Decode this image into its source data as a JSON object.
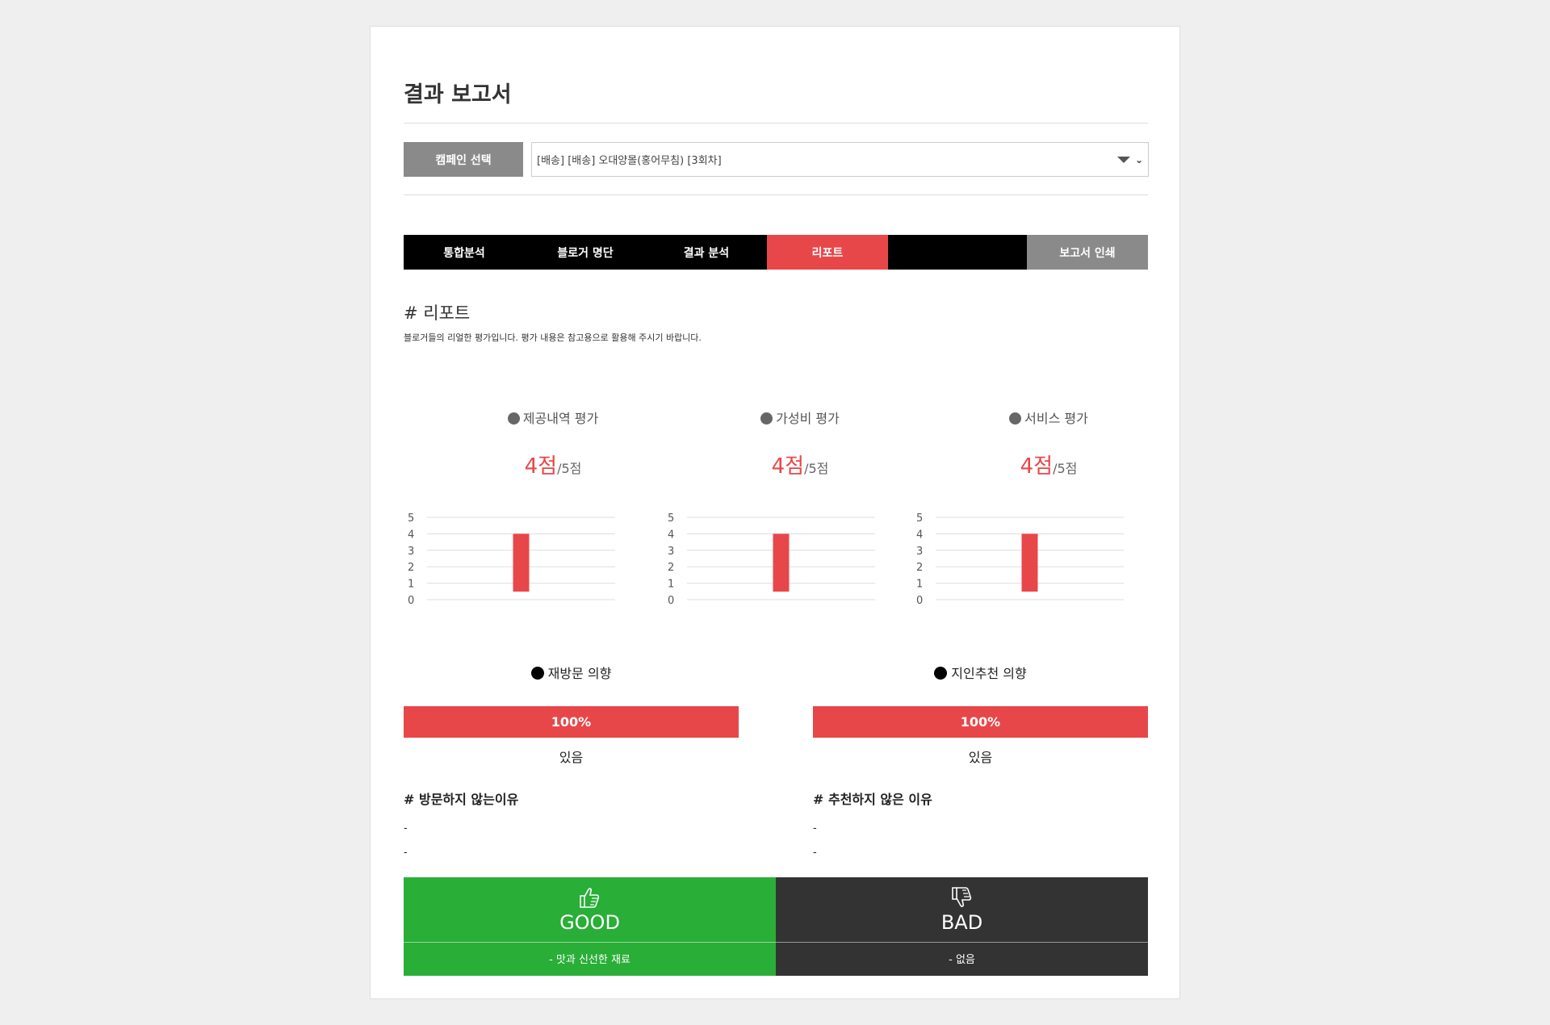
{
  "page_title": "결과 보고서",
  "campaign": {
    "label": "캠페인 선택",
    "selected": "[배송] [배송] 오대양몰(홍어무침) [3회차]"
  },
  "tabs": [
    {
      "label": "통합분석"
    },
    {
      "label": "블로거 명단"
    },
    {
      "label": "결과 분석"
    },
    {
      "label": "리포트",
      "active": true
    },
    {
      "label": "보고서 인쇄"
    }
  ],
  "report": {
    "title": "# 리포트",
    "description": "블로거들의 리얼한 평가입니다. 평가 내용은 참고용으로 활용해 주시기 바랍니다."
  },
  "metrics": [
    {
      "title": "제공내역 평가",
      "score": "4점",
      "max": "/5점"
    },
    {
      "title": "가성비 평가",
      "score": "4점",
      "max": "/5점"
    },
    {
      "title": "서비스 평가",
      "score": "4점",
      "max": "/5점"
    }
  ],
  "chart_data": [
    {
      "type": "bar",
      "categories": [
        ""
      ],
      "values": [
        4
      ],
      "ylim": [
        0,
        5
      ],
      "yticks": [
        "0",
        "1",
        "2",
        "3",
        "4",
        "5"
      ],
      "color": "#e8474a",
      "grid": true
    },
    {
      "type": "bar",
      "categories": [
        ""
      ],
      "values": [
        4
      ],
      "ylim": [
        0,
        5
      ],
      "yticks": [
        "0",
        "1",
        "2",
        "3",
        "4",
        "5"
      ],
      "color": "#e8474a",
      "grid": true
    },
    {
      "type": "bar",
      "categories": [
        ""
      ],
      "values": [
        4
      ],
      "ylim": [
        0,
        5
      ],
      "yticks": [
        "0",
        "1",
        "2",
        "3",
        "4",
        "5"
      ],
      "color": "#e8474a",
      "grid": true
    }
  ],
  "intents": [
    {
      "title": "재방문 의향",
      "percent": "100%",
      "percent_value": 100,
      "answer": "있음"
    },
    {
      "title": "지인추천 의향",
      "percent": "100%",
      "percent_value": 100,
      "answer": "있음"
    }
  ],
  "reasons": [
    {
      "title": "# 방문하지 않는이유",
      "items": [
        "-",
        "-"
      ]
    },
    {
      "title": "# 추천하지 않은 이유",
      "items": [
        "-",
        "-"
      ]
    }
  ],
  "good": {
    "label": "GOOD",
    "icon": "thumbs-up-icon",
    "comment": "- 맛과 신선한 재료",
    "color": "#29ae37"
  },
  "bad": {
    "label": "BAD",
    "icon": "thumbs-down-icon",
    "comment": "- 없음",
    "color": "#333333"
  },
  "accent_color": "#e8474a"
}
